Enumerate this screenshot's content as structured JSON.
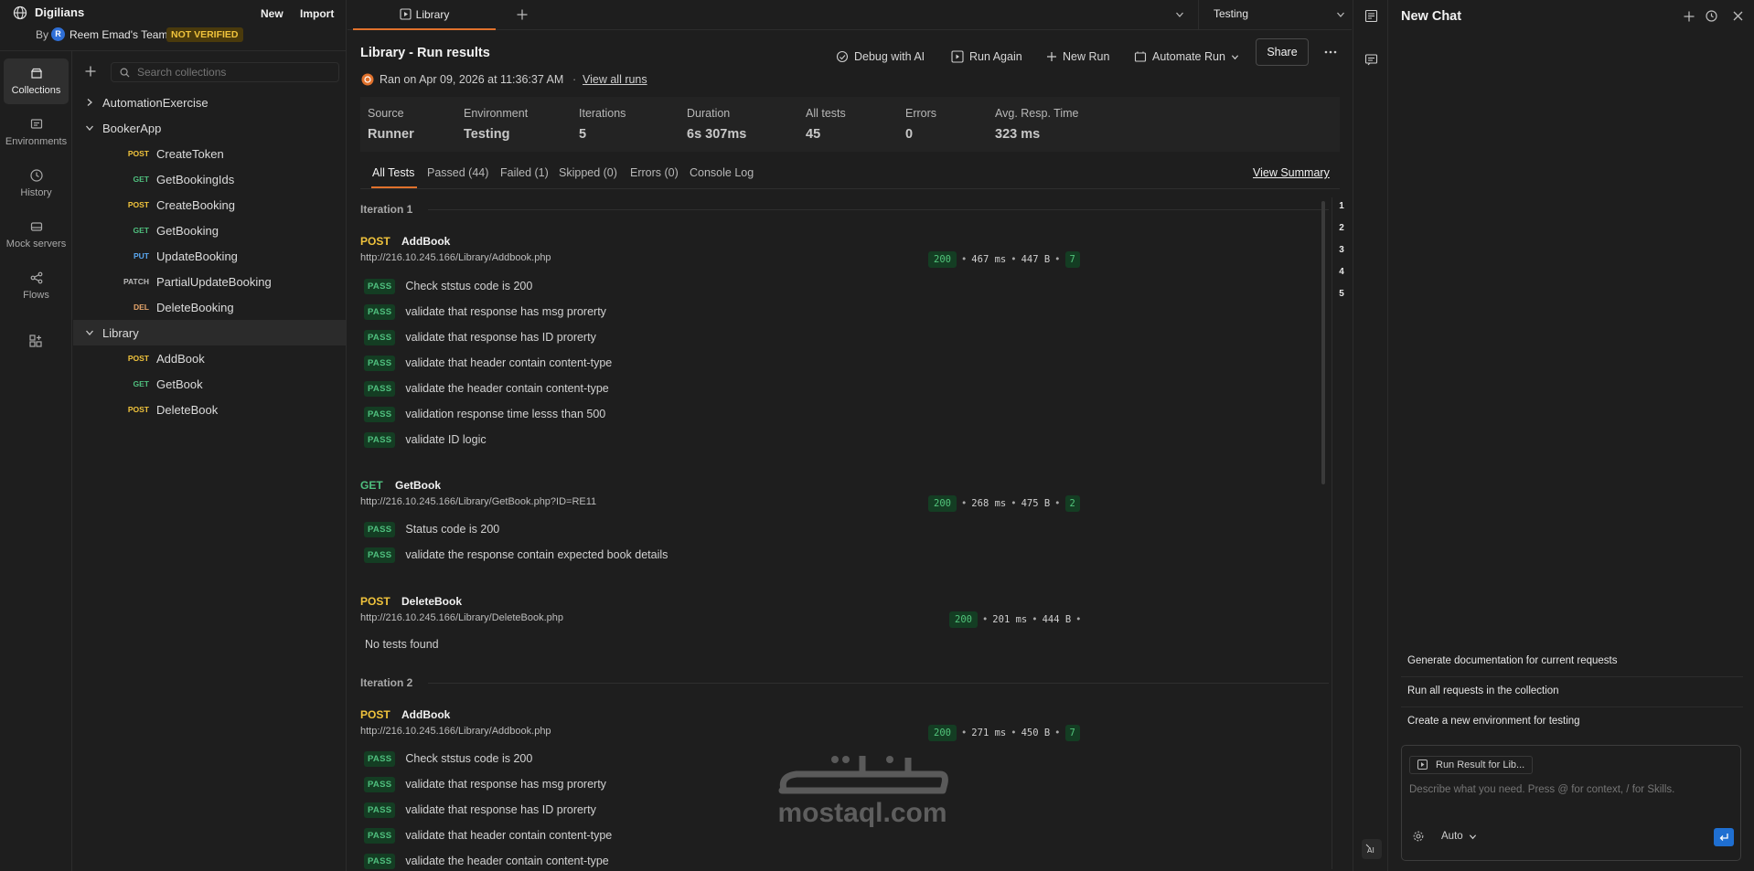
{
  "workspace": {
    "name": "Digilians",
    "by_prefix": "By",
    "team_initial": "R",
    "team": "Reem Emad's Team",
    "badge": "NOT VERIFIED",
    "new_label": "New",
    "import_label": "Import"
  },
  "rail": {
    "items": [
      {
        "label": "Collections",
        "icon": "collections-icon"
      },
      {
        "label": "Environments",
        "icon": "environments-icon"
      },
      {
        "label": "History",
        "icon": "history-icon"
      },
      {
        "label": "Mock servers",
        "icon": "mock-servers-icon"
      },
      {
        "label": "Flows",
        "icon": "flows-icon"
      }
    ]
  },
  "sidebar": {
    "search_placeholder": "Search collections",
    "collections": [
      {
        "name": "AutomationExercise",
        "expanded": false
      },
      {
        "name": "BookerApp",
        "expanded": true,
        "requests": [
          {
            "method": "POST",
            "name": "CreateToken"
          },
          {
            "method": "GET",
            "name": "GetBookingIds"
          },
          {
            "method": "POST",
            "name": "CreateBooking"
          },
          {
            "method": "GET",
            "name": "GetBooking"
          },
          {
            "method": "PUT",
            "name": "UpdateBooking"
          },
          {
            "method": "PATCH",
            "name": "PartialUpdateBooking"
          },
          {
            "method": "DEL",
            "name": "DeleteBooking"
          }
        ]
      },
      {
        "name": "Library",
        "expanded": true,
        "requests": [
          {
            "method": "POST",
            "name": "AddBook"
          },
          {
            "method": "GET",
            "name": "GetBook"
          },
          {
            "method": "POST",
            "name": "DeleteBook"
          }
        ]
      }
    ]
  },
  "tabs": {
    "active": "Library",
    "environment": "Testing"
  },
  "run": {
    "title": "Library - Run results",
    "ran_on": "Ran on Apr 09, 2026 at 11:36:37 AM",
    "separator": "·",
    "view_all_runs": "View all runs",
    "actions": {
      "debug": "Debug with AI",
      "run_again": "Run Again",
      "new_run": "New Run",
      "automate": "Automate Run",
      "share": "Share"
    },
    "stats": [
      {
        "label": "Source",
        "value": "Runner"
      },
      {
        "label": "Environment",
        "value": "Testing"
      },
      {
        "label": "Iterations",
        "value": "5"
      },
      {
        "label": "Duration",
        "value": "6s 307ms"
      },
      {
        "label": "All tests",
        "value": "45"
      },
      {
        "label": "Errors",
        "value": "0"
      },
      {
        "label": "Avg. Resp. Time",
        "value": "323 ms"
      }
    ],
    "filter_tabs": [
      "All Tests",
      "Passed (44)",
      "Failed (1)",
      "Skipped (0)",
      "Errors (0)",
      "Console Log"
    ],
    "view_summary": "View Summary",
    "iteration_nav": [
      "1",
      "2",
      "3",
      "4",
      "5"
    ],
    "pass_label": "PASS",
    "iterations": [
      {
        "label": "Iteration 1",
        "requests": [
          {
            "method": "POST",
            "name": "AddBook",
            "url": "http://216.10.245.166/Library/Addbook.php",
            "status": "200",
            "time": "467 ms",
            "size": "447 B",
            "count": "7",
            "tests": [
              "Check ststus code is 200",
              "validate that response has msg prorerty",
              "validate that response has ID prorerty",
              "validate that header contain content-type",
              "validate the header contain content-type",
              "validation response time lesss than 500",
              "validate ID logic"
            ]
          },
          {
            "method": "GET",
            "name": "GetBook",
            "url": "http://216.10.245.166/Library/GetBook.php?ID=RE11",
            "status": "200",
            "time": "268 ms",
            "size": "475 B",
            "count": "2",
            "tests": [
              "Status code is 200",
              "validate the response contain expected book details"
            ]
          },
          {
            "method": "POST",
            "name": "DeleteBook",
            "url": "http://216.10.245.166/Library/DeleteBook.php",
            "status": "200",
            "time": "201 ms",
            "size": "444 B",
            "count": "",
            "no_tests": "No tests found"
          }
        ]
      },
      {
        "label": "Iteration 2",
        "requests": [
          {
            "method": "POST",
            "name": "AddBook",
            "url": "http://216.10.245.166/Library/Addbook.php",
            "status": "200",
            "time": "271 ms",
            "size": "450 B",
            "count": "7",
            "tests": [
              "Check ststus code is 200",
              "validate that response has msg prorerty",
              "validate that response has ID prorerty",
              "validate that header contain content-type",
              "validate the header contain content-type"
            ]
          }
        ]
      }
    ]
  },
  "watermark": {
    "text": "mostaql.com"
  },
  "chat": {
    "title": "New Chat",
    "suggestions": [
      "Generate documentation for current requests",
      "Run all requests in the collection",
      "Create a new environment for testing"
    ],
    "context_chip": "Run Result for Lib...",
    "input_placeholder": "Describe what you need. Press @ for context, / for Skills.",
    "model": "Auto"
  },
  "colors": {
    "background": "#1e1e1e",
    "pass_bg": "#143d23",
    "pass_fg": "#4fbf7e",
    "post": "#f0c33c",
    "get": "#4fbf7e",
    "put": "#5aa7f0",
    "badge": "#f0c33c",
    "send": "#1f6fd1"
  }
}
